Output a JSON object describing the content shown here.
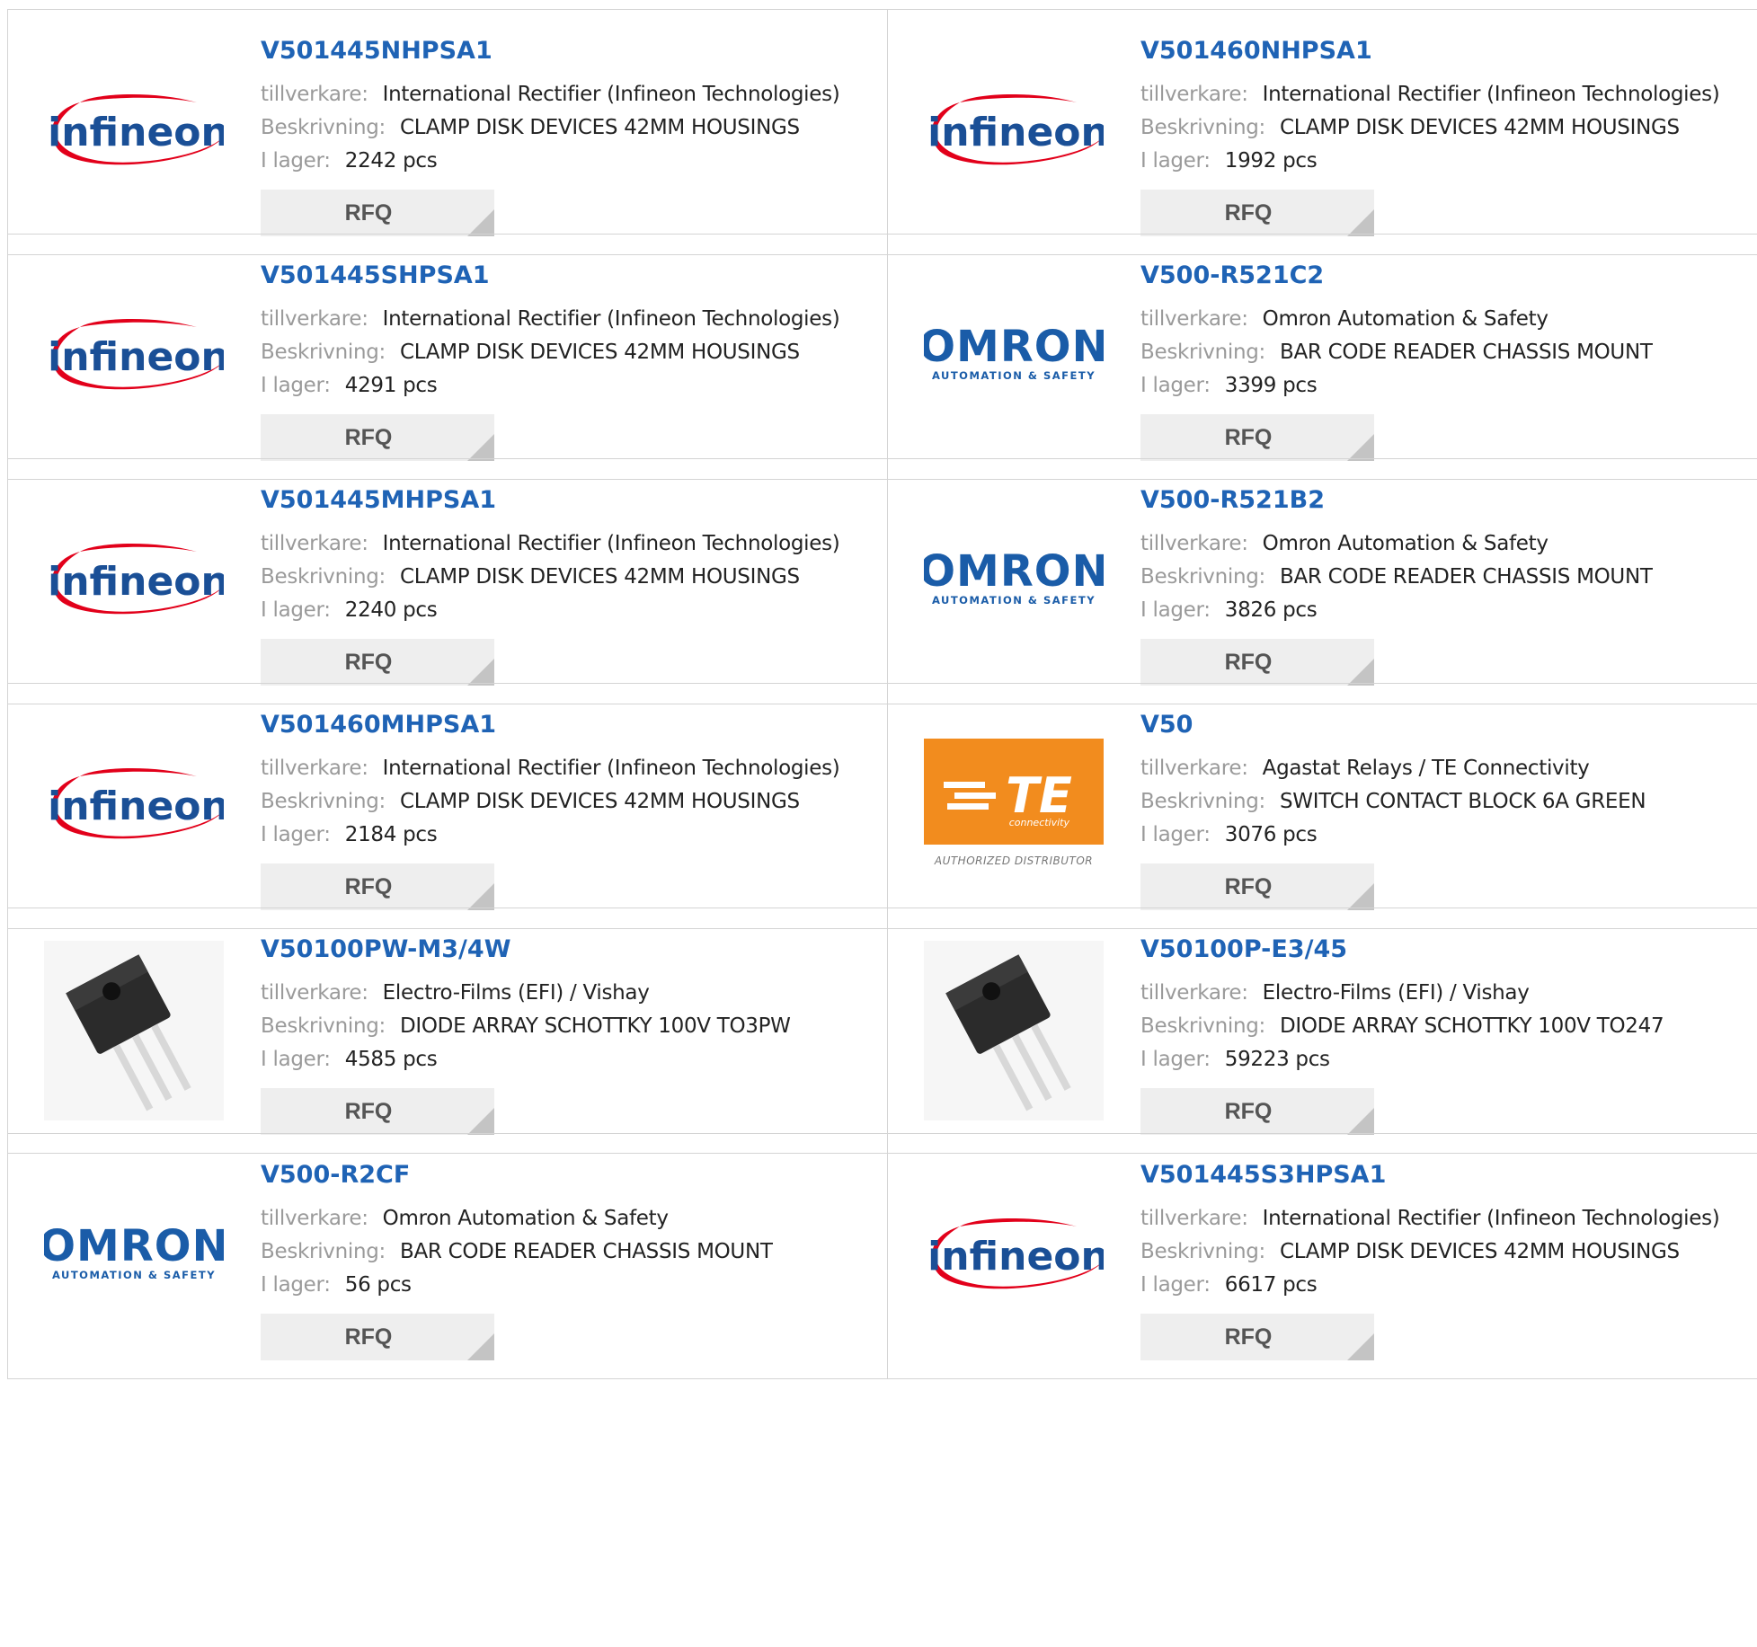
{
  "labels": {
    "manufacturer": "tillverkare:",
    "description": "Beskrivning:",
    "stock": "I lager:",
    "rfq": "RFQ"
  },
  "logos": {
    "infineon": {
      "text": "infineon",
      "color": "#1a4f96",
      "swoosh_color": "#e2001a"
    },
    "omron": {
      "text": "OMRON",
      "subtext": "AUTOMATION & SAFETY",
      "color": "#1a5ca8"
    },
    "te": {
      "text": "TE",
      "subtext": "connectivity",
      "caption": "AUTHORIZED DISTRIBUTOR",
      "color": "#f28c1e"
    }
  },
  "products": [
    {
      "part": "V501445NHPSA1",
      "logo": "infineon",
      "manufacturer": "International Rectifier (Infineon Technologies)",
      "description": "CLAMP DISK DEVICES 42MM HOUSINGS",
      "stock": "2242 pcs"
    },
    {
      "part": "V501460NHPSA1",
      "logo": "infineon",
      "manufacturer": "International Rectifier (Infineon Technologies)",
      "description": "CLAMP DISK DEVICES 42MM HOUSINGS",
      "stock": "1992 pcs"
    },
    {
      "part": "V501445SHPSA1",
      "logo": "infineon",
      "manufacturer": "International Rectifier (Infineon Technologies)",
      "description": "CLAMP DISK DEVICES 42MM HOUSINGS",
      "stock": "4291 pcs"
    },
    {
      "part": "V500-R521C2",
      "logo": "omron",
      "manufacturer": "Omron Automation & Safety",
      "description": "BAR CODE READER CHASSIS MOUNT",
      "stock": "3399 pcs"
    },
    {
      "part": "V501445MHPSA1",
      "logo": "infineon",
      "manufacturer": "International Rectifier (Infineon Technologies)",
      "description": "CLAMP DISK DEVICES 42MM HOUSINGS",
      "stock": "2240 pcs"
    },
    {
      "part": "V500-R521B2",
      "logo": "omron",
      "manufacturer": "Omron Automation & Safety",
      "description": "BAR CODE READER CHASSIS MOUNT",
      "stock": "3826 pcs"
    },
    {
      "part": "V501460MHPSA1",
      "logo": "infineon",
      "manufacturer": "International Rectifier (Infineon Technologies)",
      "description": "CLAMP DISK DEVICES 42MM HOUSINGS",
      "stock": "2184 pcs"
    },
    {
      "part": "V50",
      "logo": "te",
      "manufacturer": "Agastat Relays / TE Connectivity",
      "description": "SWITCH CONTACT BLOCK 6A GREEN",
      "stock": "3076 pcs"
    },
    {
      "part": "V50100PW-M3/4W",
      "logo": "transistor-photo",
      "manufacturer": "Electro-Films (EFI) / Vishay",
      "description": "DIODE ARRAY SCHOTTKY 100V TO3PW",
      "stock": "4585 pcs"
    },
    {
      "part": "V50100P-E3/45",
      "logo": "transistor-photo",
      "manufacturer": "Electro-Films (EFI) / Vishay",
      "description": "DIODE ARRAY SCHOTTKY 100V TO247",
      "stock": "59223 pcs"
    },
    {
      "part": "V500-R2CF",
      "logo": "omron",
      "manufacturer": "Omron Automation & Safety",
      "description": "BAR CODE READER CHASSIS MOUNT",
      "stock": "56 pcs"
    },
    {
      "part": "V501445S3HPSA1",
      "logo": "infineon",
      "manufacturer": "International Rectifier (Infineon Technologies)",
      "description": "CLAMP DISK DEVICES 42MM HOUSINGS",
      "stock": "6617 pcs"
    }
  ]
}
